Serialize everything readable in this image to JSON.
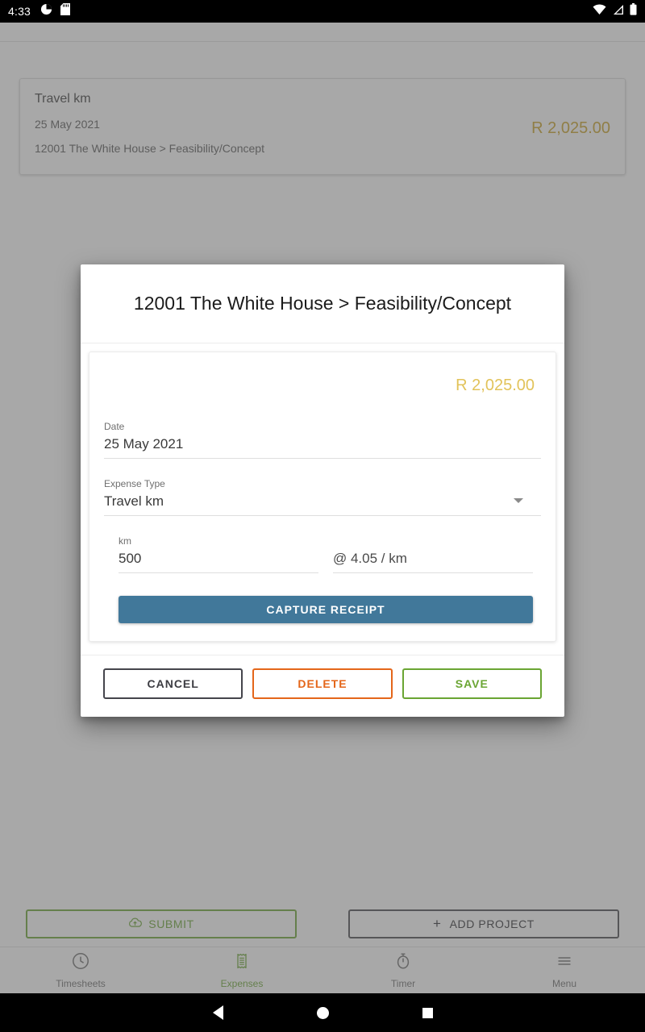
{
  "statusbar": {
    "time": "4:33",
    "left_icons": [
      "data-saver-icon",
      "sd-card-icon"
    ],
    "right_icons": [
      "wifi-icon",
      "cellular-signal-icon",
      "battery-icon"
    ]
  },
  "background": {
    "expense_card": {
      "type": "Travel km",
      "date": "25 May 2021",
      "project": "12001 The White House > Feasibility/Concept",
      "amount": "R 2,025.00"
    },
    "action_bar": {
      "submit_label": "SUBMIT",
      "submit_icon": "cloud-upload-icon",
      "add_project_label": "ADD PROJECT",
      "add_project_prefix": "+"
    },
    "bottom_nav": {
      "items": [
        {
          "label": "Timesheets",
          "icon": "clock-icon",
          "active": false
        },
        {
          "label": "Expenses",
          "icon": "receipt-icon",
          "active": true
        },
        {
          "label": "Timer",
          "icon": "stopwatch-icon",
          "active": false
        },
        {
          "label": "Menu",
          "icon": "hamburger-menu-icon",
          "active": false
        }
      ]
    }
  },
  "dialog": {
    "title": "12001 The White House > Feasibility/Concept",
    "amount": "R 2,025.00",
    "fields": {
      "date": {
        "label": "Date",
        "value": "25 May 2021"
      },
      "expense_type": {
        "label": "Expense Type",
        "value": "Travel km",
        "icon": "chevron-down-icon"
      },
      "km": {
        "label": "km",
        "value": "500"
      },
      "rate": {
        "value": "@ 4.05 / km"
      }
    },
    "capture_receipt_label": "CAPTURE RECEIPT",
    "actions": {
      "cancel": "CANCEL",
      "delete": "DELETE",
      "save": "SAVE"
    }
  },
  "android_nav": {
    "back": "back-button",
    "home": "home-button",
    "recents": "recents-button"
  },
  "colors": {
    "amount_gold": "#e2c35a",
    "capture_blue": "#41789a",
    "green": "#6aa533",
    "orange": "#e4661a",
    "dark": "#45454c"
  }
}
